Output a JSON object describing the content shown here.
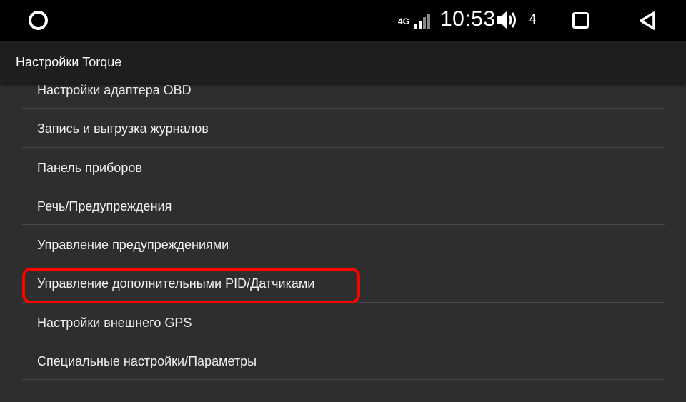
{
  "status_bar": {
    "network": "4G",
    "time": "10:53",
    "volume_level": "4",
    "icons": [
      "home-circle-icon",
      "signal-icon",
      "volume-icon",
      "recents-icon",
      "back-icon"
    ]
  },
  "app_bar": {
    "title": "Настройки Torque"
  },
  "settings": {
    "items": [
      "Настройки адаптера OBD",
      "Запись и выгрузка журналов",
      "Панель приборов",
      "Речь/Предупреждения",
      "Управление предупреждениями",
      "Управление дополнительными PID/Датчиками",
      "Настройки внешнего GPS",
      "Специальные настройки/Параметры"
    ],
    "highlighted_item": "Управление дополнительными PID/Датчиками"
  },
  "colors": {
    "status_bar_bg": "#000000",
    "app_bar_bg": "#1e1e1e",
    "list_bg": "#2e2e2e",
    "divider": "#484848",
    "highlight": "#ff0000"
  }
}
